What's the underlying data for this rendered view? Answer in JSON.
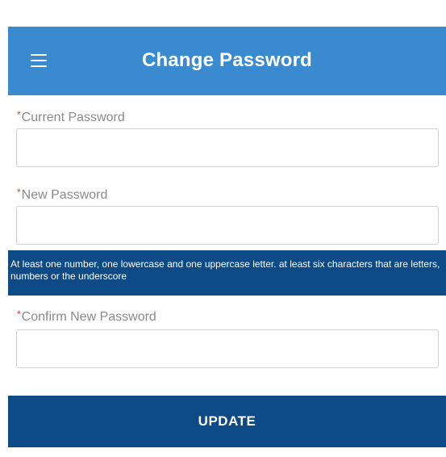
{
  "header": {
    "title": "Change Password",
    "menu_icon": "hamburger-menu-icon",
    "background_color": "#3a8ad0"
  },
  "form": {
    "required_marker": "*",
    "current_password": {
      "label": "Current Password",
      "value": "",
      "placeholder": ""
    },
    "new_password": {
      "label": "New Password",
      "value": "",
      "placeholder": ""
    },
    "password_hint": "At least one number, one lowercase and one uppercase letter. at least six characters that are letters, numbers or the underscore",
    "confirm_password": {
      "label": "Confirm New Password",
      "value": "",
      "placeholder": ""
    },
    "submit_label": "UPDATE"
  },
  "colors": {
    "accent_dark": "#0d4a86",
    "required": "#d23b3b"
  }
}
